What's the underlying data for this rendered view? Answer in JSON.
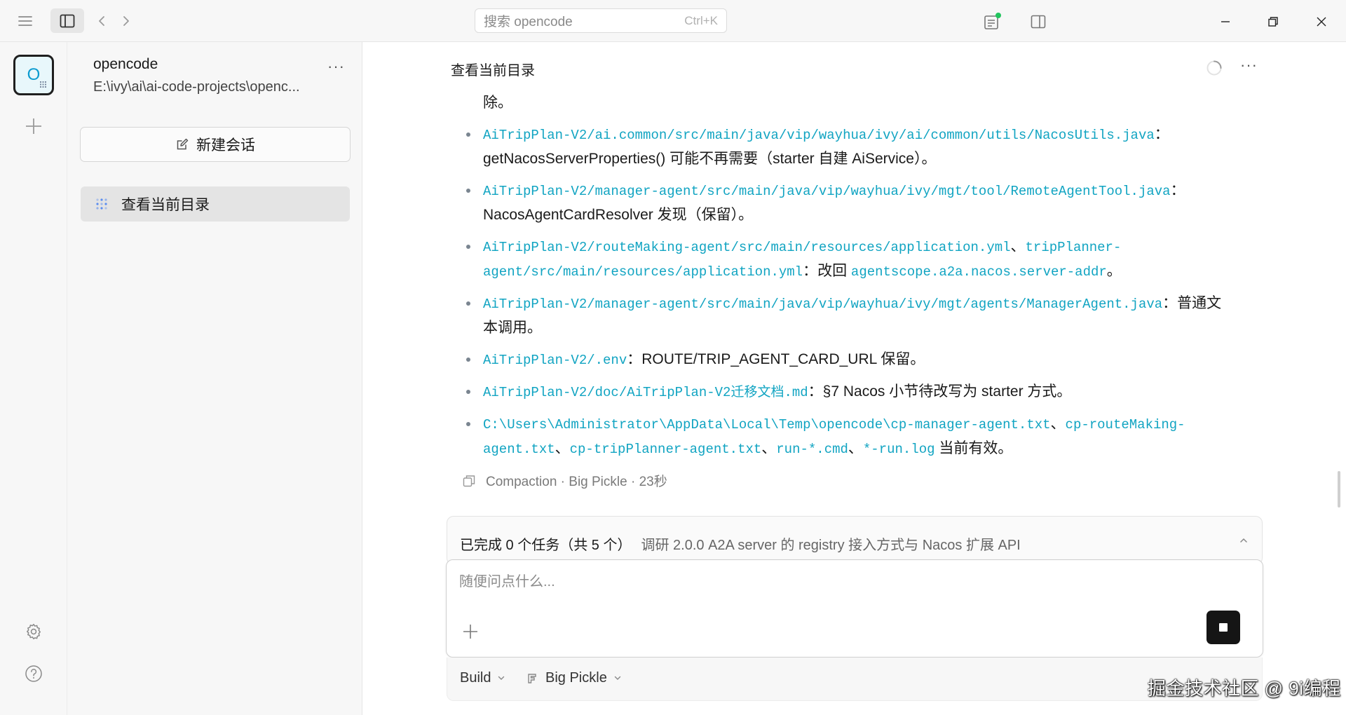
{
  "titlebar": {
    "search_placeholder": "搜索 opencode",
    "search_shortcut": "Ctrl+K",
    "status_dot_color": "#22c55e"
  },
  "rail": {
    "project_initial": "O"
  },
  "sidebar": {
    "project_name": "opencode",
    "project_path": "E:\\ivy\\ai\\ai-code-projects\\openc...",
    "more": "···",
    "new_session_label": "新建会话",
    "sessions": [
      {
        "label": "查看当前目录"
      }
    ]
  },
  "main": {
    "title": "查看当前目录",
    "more": "···",
    "continuation_text": "除。",
    "items": [
      {
        "code": "AiTripPlan-V2/ai.common/src/main/java/vip/wayhua/ivy/ai/common/utils/NacosUtils.java",
        "text": "：getNacosServerProperties() 可能不再需要（starter 自建 AiService）。"
      },
      {
        "code": "AiTripPlan-V2/manager-agent/src/main/java/vip/wayhua/ivy/mgt/tool/RemoteAgentTool.java",
        "text": "：NacosAgentCardResolver 发现（保留）。"
      },
      {
        "code": "AiTripPlan-V2/routeMaking-agent/src/main/resources/application.yml",
        "sep": "、",
        "code2": "tripPlanner-agent/src/main/resources/application.yml",
        "text": "：改回 ",
        "code3": "agentscope.a2a.nacos.server-addr",
        "text2": "。"
      },
      {
        "code": "AiTripPlan-V2/manager-agent/src/main/java/vip/wayhua/ivy/mgt/agents/ManagerAgent.java",
        "text": "：普通文本调用。"
      },
      {
        "code": "AiTripPlan-V2/.env",
        "text": "：ROUTE/TRIP_AGENT_CARD_URL 保留。"
      },
      {
        "code": "AiTripPlan-V2/doc/AiTripPlan-V2迁移文档.md",
        "text": "：§7 Nacos 小节待改写为 starter 方式。"
      },
      {
        "code": "C:\\Users\\Administrator\\AppData\\Local\\Temp\\opencode\\cp-manager-agent.txt",
        "sep": "、",
        "code2": "cp-routeMaking-agent.txt",
        "sep2": "、",
        "code3": "cp-tripPlanner-agent.txt",
        "sep3": "、",
        "code4": "run-*.cmd",
        "sep4": "、",
        "code5": "*-run.log",
        "text": " 当前有效。"
      }
    ],
    "compaction": "Compaction · Big Pickle · 23秒",
    "task_status": "已完成 0 个任务（共 5 个）",
    "task_desc": "调研 2.0.0 A2A server 的 registry 接入方式与 Nacos 扩展 API",
    "composer_placeholder": "随便问点什么...",
    "mode_label": "Build",
    "model_label": "Big Pickle"
  },
  "watermark": "掘金技术社区 @ 9i编程"
}
